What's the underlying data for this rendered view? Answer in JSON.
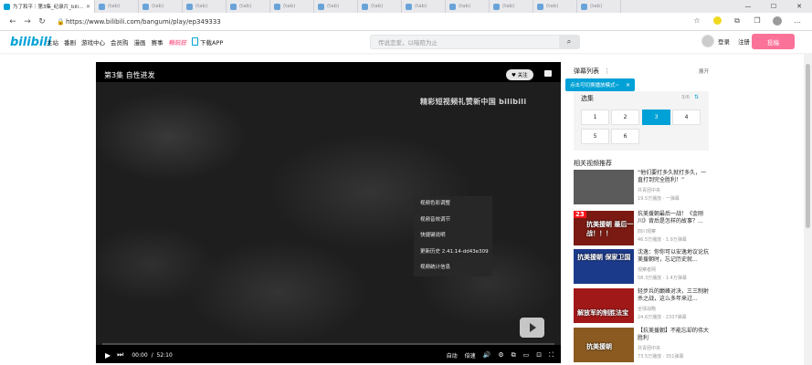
{
  "browser": {
    "active_tab_title": "为了和平｜第3集_纪录片_bilibili",
    "other_tabs": [
      "(tab)",
      "(tab)",
      "(tab)",
      "(tab)",
      "(tab)",
      "(tab)",
      "(tab)",
      "(tab)",
      "(tab)",
      "(tab)",
      "(tab)",
      "(tab)"
    ],
    "url": "https://www.bilibili.com/bangumi/play/ep349333"
  },
  "header": {
    "logo_text": "bilibili",
    "nav": [
      "主站",
      "番剧",
      "游戏中心",
      "会员购",
      "漫画",
      "赛事"
    ],
    "nav_highlight": "畅玩狂",
    "download_label": "下载APP",
    "search_placeholder": "传说恋爱，以暗陪为止",
    "login_label": "登录",
    "register_label": "注册",
    "upload_label": "投稿"
  },
  "player": {
    "episode_title": "第3集 自性进发",
    "like_label": "♥ 关注",
    "watermark": "精彩短视频礼赞新中国 bilibili",
    "context_menu": [
      "视频色彩调整",
      "视频音效调节",
      "快捷键说明",
      "更新历史 2.41.14-dd43e309",
      "视频统计信息"
    ],
    "time_current": "00:00",
    "time_total": "52:10",
    "quality_label": "自动",
    "speed_label": "倍速"
  },
  "side": {
    "danmaku_title": "弹幕列表",
    "danmaku_expand": "展开",
    "tip_text": "点击可切换播放模式~",
    "episodes_title": "选集",
    "episodes_count": "3/6",
    "episodes": [
      "1",
      "2",
      "3",
      "4",
      "5",
      "6"
    ],
    "current_episode": "3",
    "related_title": "相关视频推荐",
    "related": [
      {
        "title": "“他们要打多久就打多久，一直打到完全胜利！”",
        "up": "共青团中央",
        "stats": "19.5万播放 · 一弹幕",
        "thumb_color": "#5b5b5b"
      },
      {
        "title": "抗美援朝最后一战！《金刚川》背后是怎样的故事？...",
        "up": "四川观察",
        "stats": "46.5万播放 · 1.9万弹幕",
        "thumb_color": "#7a1a12",
        "badge": "23",
        "overlay": "抗美援朝 最后一战！！！"
      },
      {
        "title": "沈逸：你你可以安逸地议论抗美援朝时，忘记历史就...",
        "up": "观察者网",
        "stats": "58.3万播放 · 1.4万弹幕",
        "thumb_color": "#1c3a8a",
        "overlay": "抗美援朝 保家卫国"
      },
      {
        "title": "轻步兵的巅峰对决，三三制射杀之战，这么多年来过...",
        "up": "全球战略",
        "stats": "24.6万播放 · 2337弹幕",
        "thumb_color": "#a01818",
        "overlay": "解放军的制胜法宝"
      },
      {
        "title": "【抗美援朝】不能忘却的伟大胜利",
        "up": "共青团中央",
        "stats": "73.5万播放 · 351弹幕",
        "thumb_color": "#8a5a20",
        "overlay": "抗美援朝"
      }
    ]
  },
  "colors": {
    "accent": "#00a1d6",
    "pink": "#fb7299"
  }
}
